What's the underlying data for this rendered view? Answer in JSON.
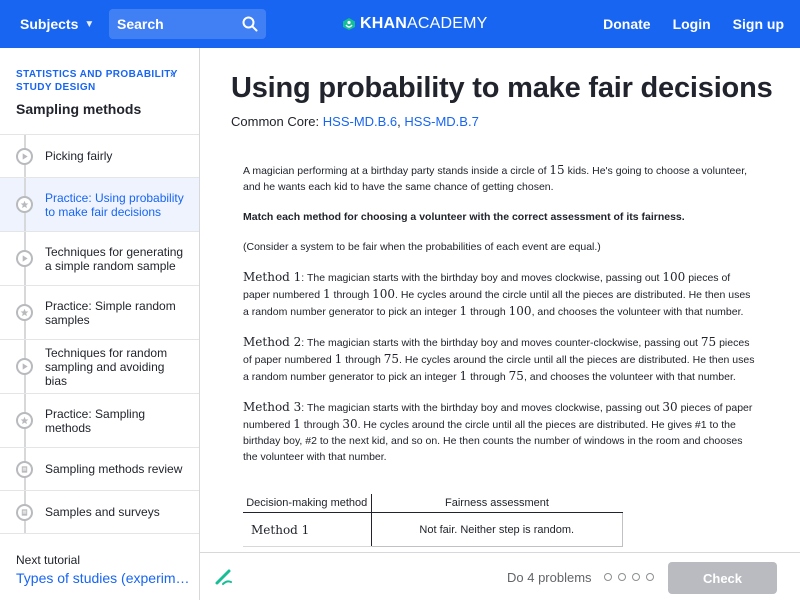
{
  "nav": {
    "subjects": "Subjects",
    "search_placeholder": "Search",
    "logo_bold": "KHAN",
    "logo_light": "ACADEMY",
    "donate": "Donate",
    "login": "Login",
    "signup": "Sign up"
  },
  "sidebar": {
    "breadcrumb_1": "STATISTICS AND PROBABILITY",
    "breadcrumb_2": "STUDY DESIGN",
    "unit_title": "Sampling methods",
    "items": [
      {
        "label": "Picking fairly",
        "icon": "play-icon",
        "active": false
      },
      {
        "label": "Practice: Using probability to make fair decisions",
        "icon": "star-icon",
        "active": true
      },
      {
        "label": "Techniques for generating a simple random sample",
        "icon": "play-icon",
        "active": false
      },
      {
        "label": "Practice: Simple random samples",
        "icon": "star-icon",
        "active": false
      },
      {
        "label": "Techniques for random sampling and avoiding bias",
        "icon": "play-icon",
        "active": false
      },
      {
        "label": "Practice: Sampling methods",
        "icon": "star-icon",
        "active": false
      },
      {
        "label": "Sampling methods review",
        "icon": "article-icon",
        "active": false
      },
      {
        "label": "Samples and surveys",
        "icon": "article-icon",
        "active": false
      }
    ],
    "next_label": "Next tutorial",
    "next_link": "Types of studies (experiments vs. observational studies)"
  },
  "main": {
    "title": "Using probability to make fair decisions",
    "common_core_label": "Common Core:",
    "standard_1": "HSS-MD.B.6",
    "standard_2": "HSS-MD.B.7",
    "intro_a": "A magician performing at a birthday party stands inside a circle of",
    "intro_num": "15",
    "intro_b": "kids. He's going to choose a volunteer, and he wants each kid to have the same chance of getting chosen.",
    "instruction": "Match each method for choosing a volunteer with the correct assessment of its fairness.",
    "note": "(Consider a system to be fair when the probabilities of each event are equal.)",
    "method1_label": "Method 1",
    "method1_a": ": The magician starts with the birthday boy and moves clockwise, passing out",
    "method1_n1": "100",
    "method1_b": "pieces of paper numbered",
    "method1_n2": "1",
    "method1_c": "through",
    "method1_n3": "100",
    "method1_d": ". He cycles around the circle until all the pieces are distributed. He then uses a random number generator to pick an integer",
    "method1_n4": "1",
    "method1_e": "through",
    "method1_n5": "100",
    "method1_f": ", and chooses the volunteer with that number.",
    "method2_label": "Method 2",
    "method2_a": ": The magician starts with the birthday boy and moves counter-clockwise, passing out",
    "method2_n1": "75",
    "method2_b": "pieces of paper numbered",
    "method2_n2": "1",
    "method2_c": "through",
    "method2_n3": "75",
    "method2_d": ". He cycles around the circle until all the pieces are distributed. He then uses a random number generator to pick an integer",
    "method2_n4": "1",
    "method2_e": "through",
    "method2_n5": "75",
    "method2_f": ", and chooses the volunteer with that number.",
    "method3_label": "Method 3",
    "method3_a": ": The magician starts with the birthday boy and moves clockwise, passing out",
    "method3_n1": "30",
    "method3_b": "pieces of paper numbered",
    "method3_n2": "1",
    "method3_c": "through",
    "method3_n3": "30",
    "method3_d": ". He cycles around the circle until all the pieces are distributed. He gives #1 to the birthday boy, #2 to the next kid, and so on. He then counts the number of windows in the room and chooses the volunteer with that number.",
    "table": {
      "col1": "Decision-making method",
      "col2": "Fairness assessment",
      "row1_method": "Method 1",
      "row1_assessment": "Not fair. Neither step is random."
    }
  },
  "footer": {
    "do_problems": "Do 4 problems",
    "check": "Check"
  },
  "colors": {
    "brand": "#1865f2",
    "logo_leaf": "#14bf96",
    "check_disabled": "#b9bbc0"
  }
}
